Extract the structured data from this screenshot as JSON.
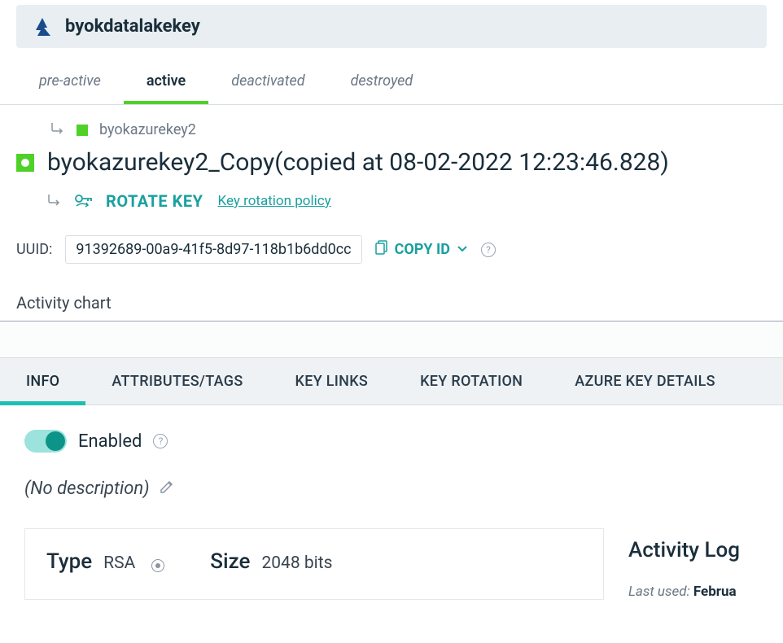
{
  "header": {
    "title": "byokdatalakekey"
  },
  "status_tabs": {
    "pre_active": "pre-active",
    "active": "active",
    "deactivated": "deactivated",
    "destroyed": "destroyed"
  },
  "breadcrumb": {
    "parent_key": "byokazurekey2"
  },
  "key": {
    "title": "byokazurekey2_Copy(copied at 08-02-2022 12:23:46.828)"
  },
  "rotate": {
    "label": "ROTATE KEY",
    "policy_link": "Key rotation policy"
  },
  "uuid": {
    "label": "UUID:",
    "value": "91392689-00a9-41f5-8d97-118b1b6dd0cc",
    "copy_label": "COPY ID"
  },
  "activity_chart": {
    "label": "Activity chart"
  },
  "subtabs": {
    "info": "INFO",
    "attributes": "ATTRIBUTES/TAGS",
    "key_links": "KEY LINKS",
    "key_rotation": "KEY ROTATION",
    "azure_details": "AZURE KEY DETAILS"
  },
  "info": {
    "enabled_label": "Enabled",
    "description": "(No description)",
    "type_label": "Type",
    "type_value": "RSA",
    "size_label": "Size",
    "size_value": "2048 bits"
  },
  "activity_log": {
    "title": "Activity Log",
    "last_used_label": "Last used:",
    "last_used_value": "Februa"
  }
}
